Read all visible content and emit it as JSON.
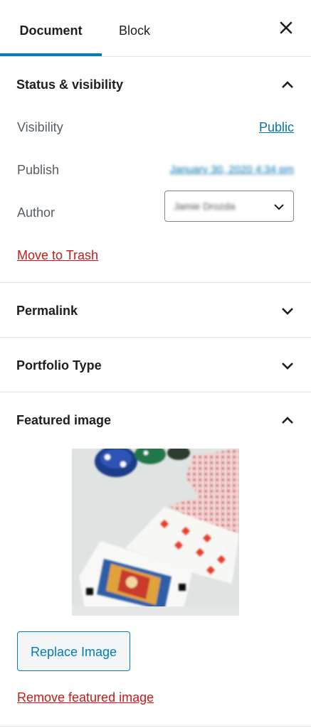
{
  "tabs": {
    "document": "Document",
    "block": "Block"
  },
  "icons": {
    "close": "close-icon",
    "chevron_up": "chevron-up-icon",
    "chevron_down": "chevron-down-icon"
  },
  "colors": {
    "accent": "#007cba",
    "link": "#0073aa",
    "danger": "#cc1818",
    "border": "#e2e4e7"
  },
  "status": {
    "title": "Status & visibility",
    "visibility_label": "Visibility",
    "visibility_value": "Public",
    "publish_label": "Publish",
    "publish_value": "January 30, 2020 4:34 pm",
    "author_label": "Author",
    "author_value": "Jamie Drozda",
    "trash_label": "Move to Trash"
  },
  "permalink": {
    "title": "Permalink"
  },
  "portfolio_type": {
    "title": "Portfolio Type"
  },
  "featured": {
    "title": "Featured image",
    "image_alt": "Playing cards and poker chips",
    "replace_label": "Replace Image",
    "remove_label": "Remove featured image"
  }
}
